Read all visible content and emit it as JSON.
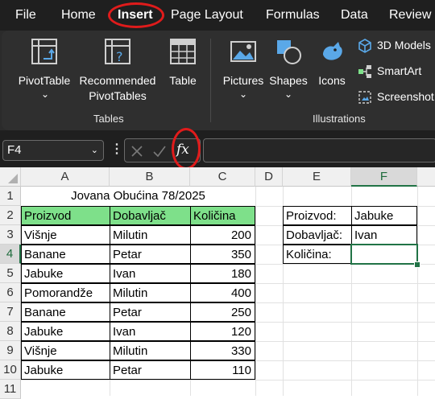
{
  "menu": {
    "tabs": [
      {
        "label": "File"
      },
      {
        "label": "Home"
      },
      {
        "label": "Insert"
      },
      {
        "label": "Page Layout"
      },
      {
        "label": "Formulas"
      },
      {
        "label": "Data"
      },
      {
        "label": "Review"
      }
    ],
    "active_tab": "Insert"
  },
  "ribbon": {
    "tables_group": {
      "label": "Tables",
      "pivottable": "PivotTable",
      "recommended_line1": "Recommended",
      "recommended_line2": "PivotTables",
      "table": "Table"
    },
    "illustrations_group": {
      "label": "Illustrations",
      "pictures": "Pictures",
      "shapes": "Shapes",
      "icons": "Icons",
      "models3d": "3D Models",
      "smartart": "SmartArt",
      "screenshot": "Screenshot"
    }
  },
  "formula_bar": {
    "name_box": "F4",
    "fx": "fx",
    "formula": ""
  },
  "sheet": {
    "columns": [
      "A",
      "B",
      "C",
      "D",
      "E",
      "F"
    ],
    "selected_column": "F",
    "rows": [
      "1",
      "2",
      "3",
      "4",
      "5",
      "6",
      "7",
      "8",
      "9",
      "10",
      "11"
    ],
    "selected_row": "4",
    "title": "Jovana Obućina 78/2025",
    "table_headers": [
      "Proizvod",
      "Dobavljač",
      "Količina"
    ],
    "table_rows": [
      [
        "Višnje",
        "Milutin",
        "200"
      ],
      [
        "Banane",
        "Petar",
        "350"
      ],
      [
        "Jabuke",
        "Ivan",
        "180"
      ],
      [
        "Pomorandže",
        "Milutin",
        "400"
      ],
      [
        "Banane",
        "Petar",
        "250"
      ],
      [
        "Jabuke",
        "Ivan",
        "120"
      ],
      [
        "Višnje",
        "Milutin",
        "330"
      ],
      [
        "Jabuke",
        "Petar",
        "110"
      ]
    ],
    "lookup": {
      "label_product": "Proizvod:",
      "value_product": "Jabuke",
      "label_supplier": "Dobavljač:",
      "value_supplier": "Ivan",
      "label_quantity": "Količina:",
      "value_quantity": ""
    },
    "colors": {
      "header_fill": "#7ee08a",
      "selection": "#217346",
      "annotation": "#e01b1b"
    }
  }
}
